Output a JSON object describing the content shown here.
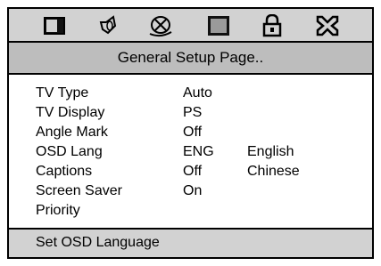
{
  "icons": [
    {
      "name": "tv-screen-icon"
    },
    {
      "name": "speaker-icon"
    },
    {
      "name": "disc-cross-icon"
    },
    {
      "name": "video-square-icon"
    },
    {
      "name": "padlock-icon"
    },
    {
      "name": "exit-cross-icon"
    }
  ],
  "page_title": "General Setup Page..",
  "settings": [
    {
      "label": "TV Type",
      "value": "Auto"
    },
    {
      "label": "TV Display",
      "value": "PS"
    },
    {
      "label": "Angle Mark",
      "value": "Off"
    },
    {
      "label": "OSD Lang",
      "value": "ENG",
      "option": "English"
    },
    {
      "label": "Captions",
      "value": "Off",
      "option": "Chinese"
    },
    {
      "label": "Screen Saver",
      "value": "On"
    },
    {
      "label": "Priority",
      "value": ""
    }
  ],
  "status_text": "Set OSD Language"
}
